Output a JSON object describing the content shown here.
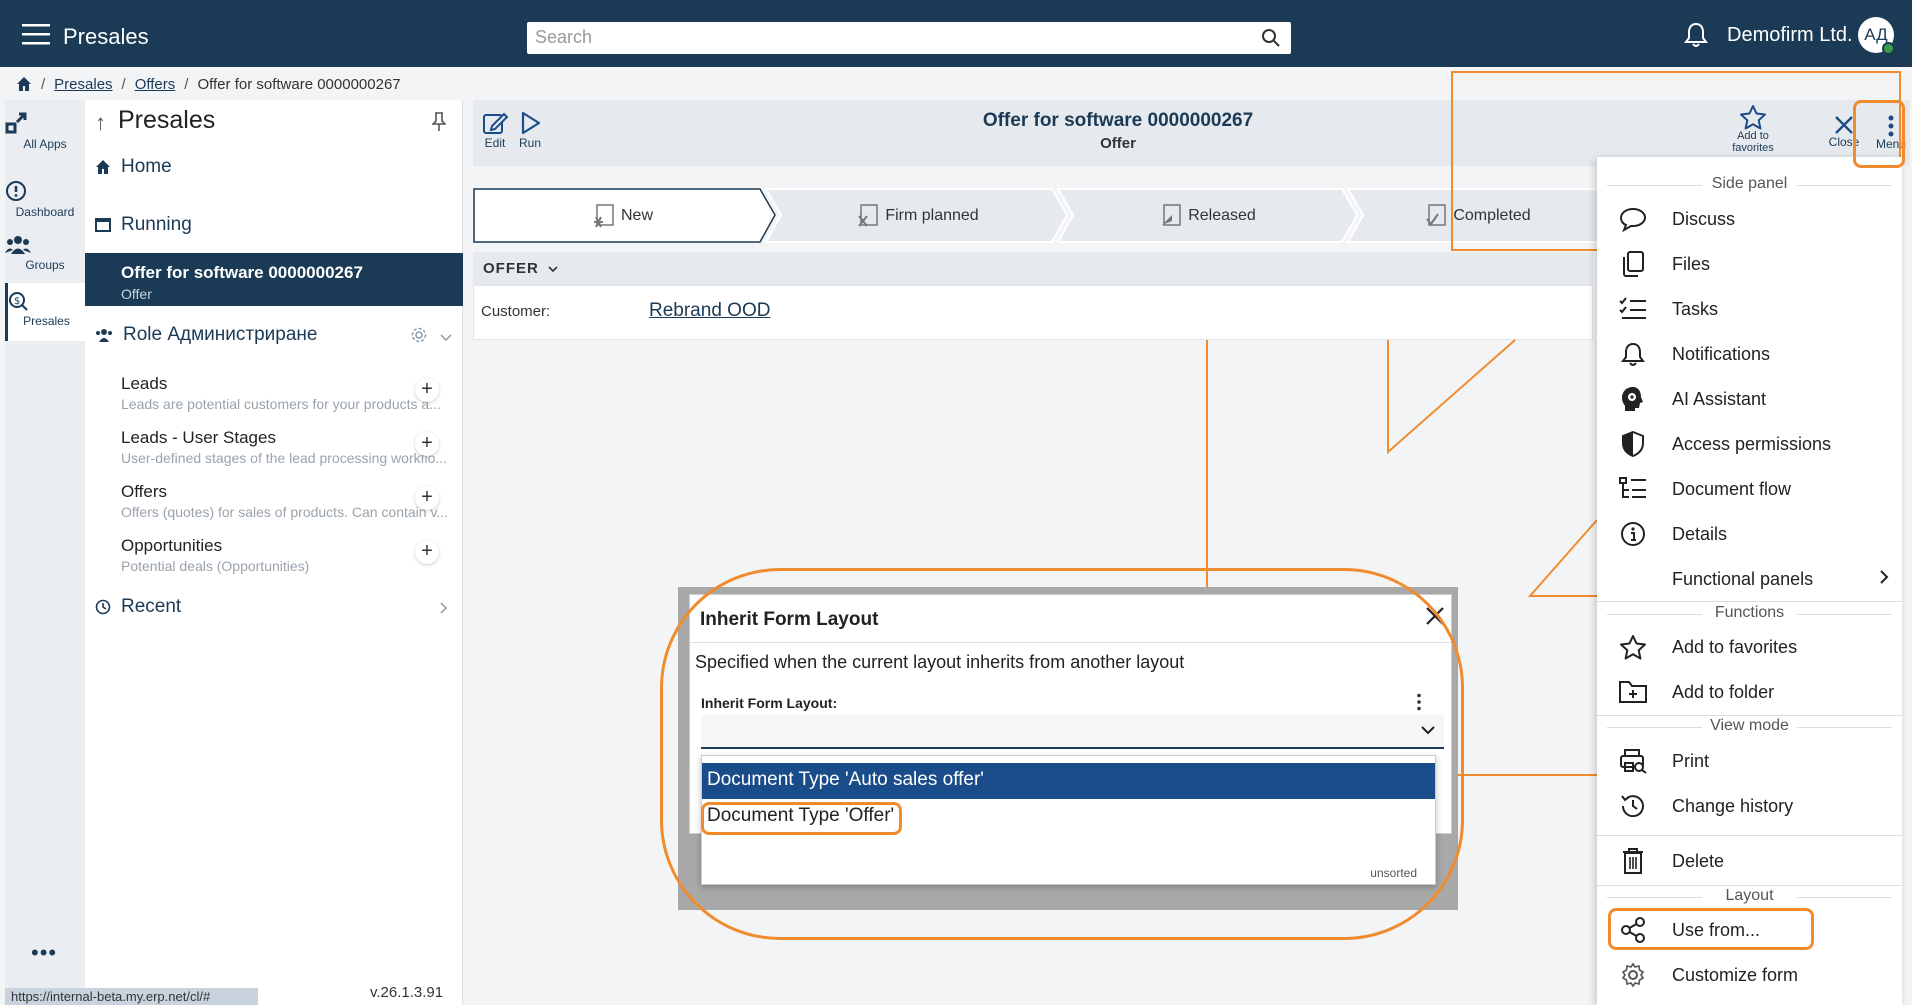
{
  "topbar": {
    "app_title": "Presales",
    "search_placeholder": "Search",
    "company": "Demofirm Ltd.",
    "avatar_initials": "АД"
  },
  "breadcrumb": {
    "items": [
      "Presales",
      "Offers"
    ],
    "current": "Offer for software 0000000267"
  },
  "rail": {
    "items": [
      {
        "label": "All Apps"
      },
      {
        "label": "Dashboard"
      },
      {
        "label": "Groups"
      },
      {
        "label": "Presales"
      }
    ],
    "more": "•••"
  },
  "nav": {
    "title": "Presales",
    "home": "Home",
    "running": "Running",
    "selected_title": "Offer for software 0000000267",
    "selected_sub": "Offer",
    "role": "Role Администриране",
    "entries": [
      {
        "title": "Leads",
        "desc": "Leads are potential customers for your products a..."
      },
      {
        "title": "Leads - User Stages",
        "desc": "User-defined stages of the lead processing workflo..."
      },
      {
        "title": "Offers",
        "desc": "Offers (quotes) for sales of products. Can contain v..."
      },
      {
        "title": "Opportunities",
        "desc": "Potential deals (Opportunities)"
      }
    ],
    "recent": "Recent",
    "version": "v.26.1.3.91",
    "url_status": "https://internal-beta.my.erp.net/cl/#"
  },
  "doc": {
    "edit_label": "Edit",
    "run_label": "Run",
    "title": "Offer for software 0000000267",
    "subtitle": "Offer",
    "favorites_label": "Add to favorites",
    "close_label": "Close",
    "menu_label": "Menu",
    "stages": [
      "New",
      "Firm planned",
      "Released",
      "Completed"
    ],
    "section": "OFFER",
    "customer_label": "Customer:",
    "customer_value": "Rebrand OOD"
  },
  "dialog": {
    "title": "Inherit Form Layout",
    "description": "Specified when the current layout inherits from another layout",
    "field_label": "Inherit Form Layout:",
    "value": "",
    "options": [
      "Document Type 'Auto sales offer'",
      "Document Type 'Offer'"
    ],
    "footer": "unsorted"
  },
  "menu": {
    "side_panel_header": "Side panel",
    "side_panel": [
      "Discuss",
      "Files",
      "Tasks",
      "Notifications",
      "AI Assistant",
      "Access permissions",
      "Document flow",
      "Details",
      "Functional panels"
    ],
    "functions_header": "Functions",
    "functions": [
      "Add to favorites",
      "Add to folder"
    ],
    "view_mode_header": "View mode",
    "view_mode": [
      "Print",
      "Change history"
    ],
    "delete": "Delete",
    "layout_header": "Layout",
    "layout": [
      "Use from...",
      "Customize form"
    ]
  },
  "colors": {
    "brand": "#1b3a55",
    "highlight": "#f08c2e",
    "selected_option": "#1b4c8a"
  }
}
